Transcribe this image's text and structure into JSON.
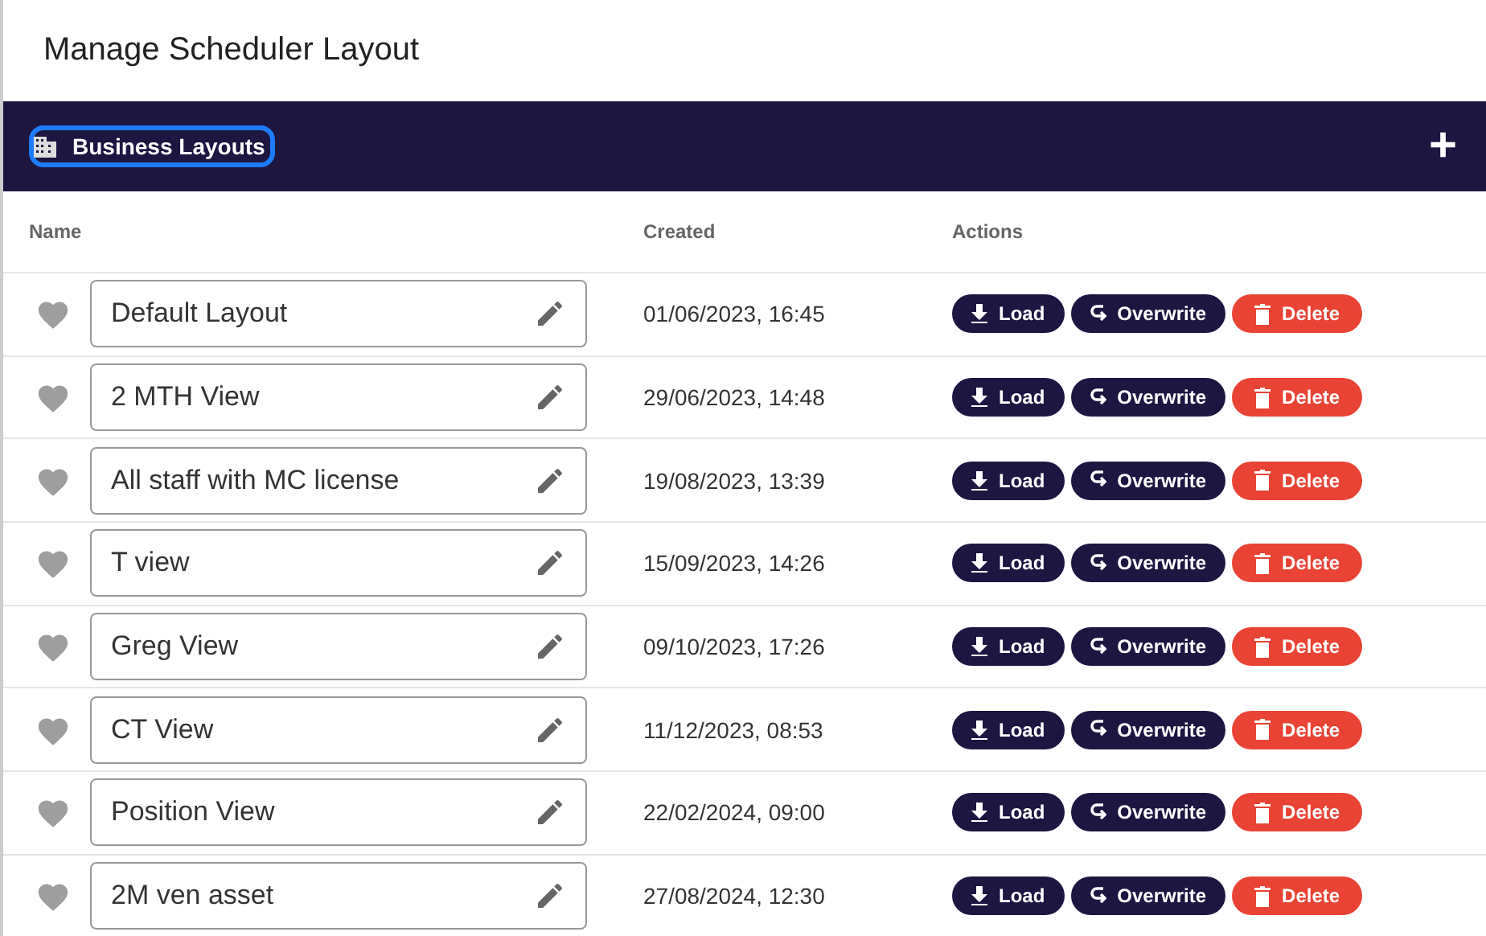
{
  "dialog": {
    "title": "Manage Scheduler Layout"
  },
  "tabs": [
    {
      "label": "Business Layouts",
      "selected": true
    }
  ],
  "add_button": {
    "label": "+"
  },
  "table": {
    "columns": [
      "Name",
      "Created",
      "Actions"
    ],
    "rows": [
      {
        "name": "Default Layout",
        "created": "01/06/2023, 16:45",
        "favorite": false,
        "actions": [
          "Load",
          "Overwrite",
          "Delete"
        ]
      },
      {
        "name": "2 MTH View",
        "created": "29/06/2023, 14:48",
        "favorite": false,
        "actions": [
          "Load",
          "Overwrite",
          "Delete"
        ]
      },
      {
        "name": "All staff with MC license",
        "created": "19/08/2023, 13:39",
        "favorite": false,
        "actions": [
          "Load",
          "Overwrite",
          "Delete"
        ]
      },
      {
        "name": "T view",
        "created": "15/09/2023, 14:26",
        "favorite": false,
        "actions": [
          "Load",
          "Overwrite",
          "Delete"
        ]
      },
      {
        "name": "Greg View",
        "created": "09/10/2023, 17:26",
        "favorite": false,
        "actions": [
          "Load",
          "Overwrite",
          "Delete"
        ]
      },
      {
        "name": "CT View",
        "created": "11/12/2023, 08:53",
        "favorite": false,
        "actions": [
          "Load",
          "Overwrite",
          "Delete"
        ]
      },
      {
        "name": "Position View",
        "created": "22/02/2024, 09:00",
        "favorite": false,
        "actions": [
          "Load",
          "Overwrite",
          "Delete"
        ]
      },
      {
        "name": "2M ven asset",
        "created": "27/08/2024, 12:30",
        "favorite": false,
        "actions": [
          "Load",
          "Overwrite",
          "Delete"
        ]
      }
    ]
  }
}
